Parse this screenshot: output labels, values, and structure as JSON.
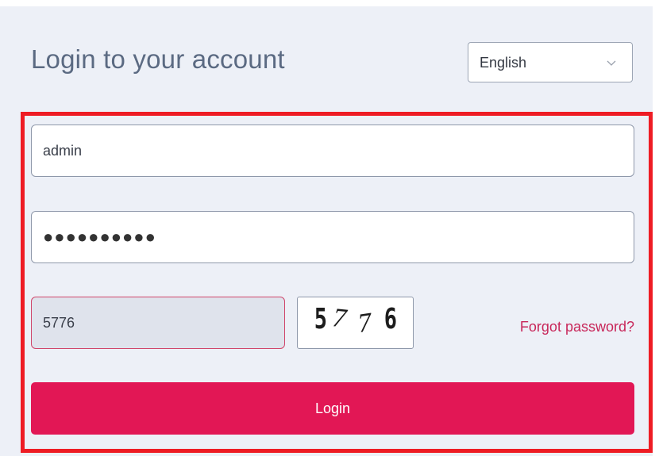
{
  "header": {
    "title": "Login to your account"
  },
  "language_select": {
    "selected": "English"
  },
  "form": {
    "username_value": "admin",
    "password_masked": "●●●●●●●●●●",
    "captcha_input_value": "5776",
    "captcha_chars": [
      "5",
      "7",
      "7",
      "6"
    ],
    "forgot_label": "Forgot password?",
    "login_label": "Login"
  },
  "colors": {
    "panel_bg": "#edf0f7",
    "title_text": "#5b6a82",
    "highlight_border": "#ee1c24",
    "accent": "#e21755",
    "link": "#c8275a",
    "captcha_input_bg": "#dfe3ec"
  },
  "icons": {
    "language_dropdown": "chevron-down-icon"
  }
}
